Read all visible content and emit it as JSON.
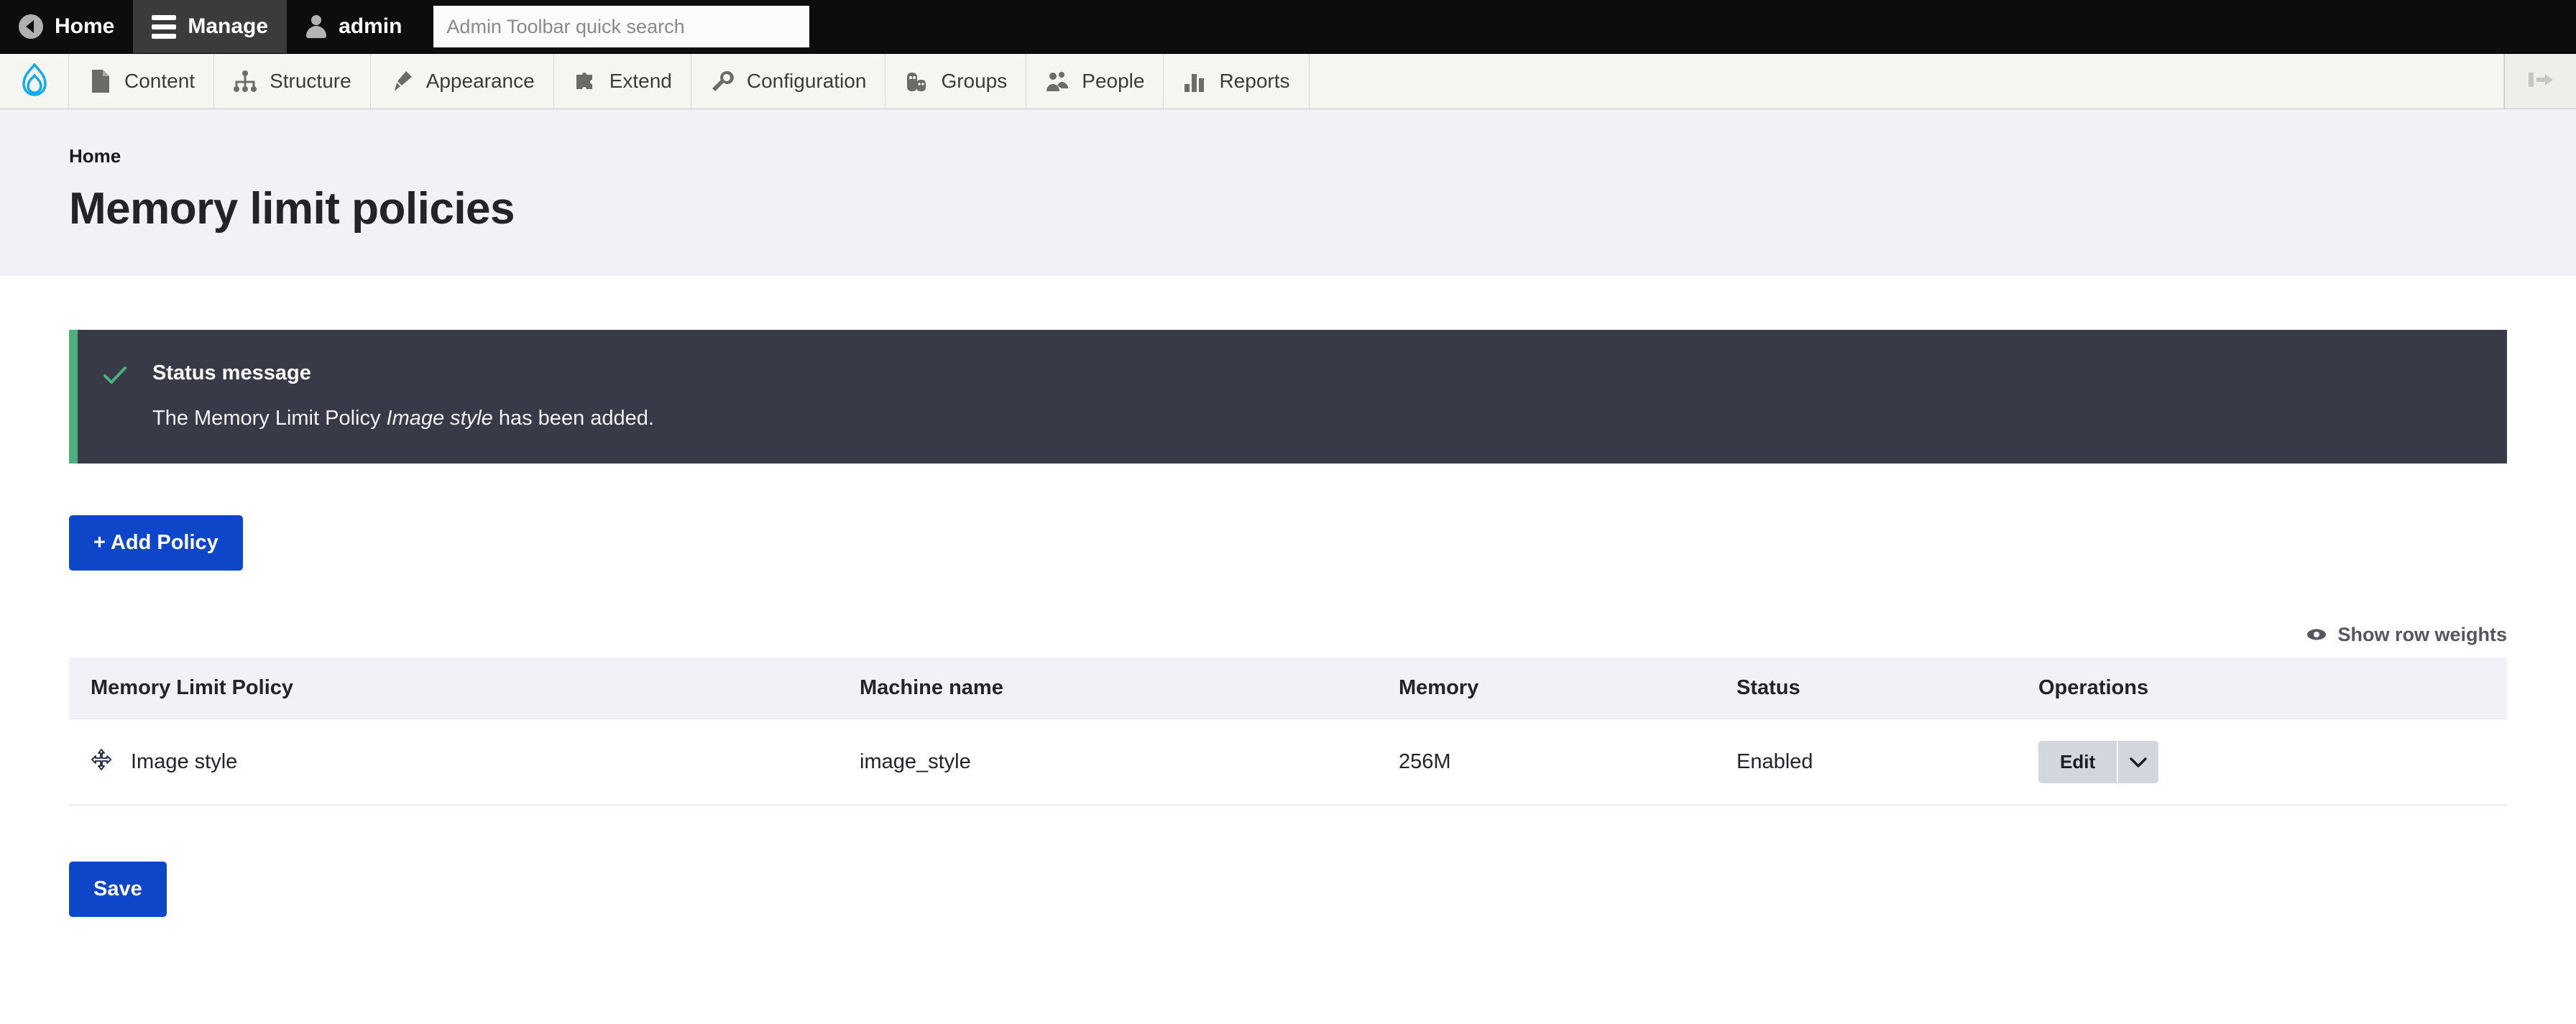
{
  "toolbar_top": {
    "tabs": [
      {
        "label": "Home",
        "icon": "home-back-icon",
        "active": false
      },
      {
        "label": "Manage",
        "icon": "hamburger-icon",
        "active": true
      },
      {
        "label": "admin",
        "icon": "user-icon",
        "active": false
      }
    ],
    "search": {
      "placeholder": "Admin Toolbar quick search",
      "value": ""
    }
  },
  "admin_menu": {
    "logo": "drupal-drop-logo",
    "items": [
      {
        "label": "Content",
        "icon": "document-icon"
      },
      {
        "label": "Structure",
        "icon": "sitemap-icon"
      },
      {
        "label": "Appearance",
        "icon": "paintbrush-icon"
      },
      {
        "label": "Extend",
        "icon": "puzzle-piece-icon"
      },
      {
        "label": "Configuration",
        "icon": "wrench-icon"
      },
      {
        "label": "Groups",
        "icon": "people-group-icon"
      },
      {
        "label": "People",
        "icon": "person-group-icon"
      },
      {
        "label": "Reports",
        "icon": "bar-chart-icon"
      }
    ],
    "orientation_toggle": "collapse-sidebar-icon"
  },
  "page": {
    "breadcrumb": "Home",
    "title": "Memory limit policies"
  },
  "status_message": {
    "icon": "checkmark-icon",
    "title": "Status message",
    "text_before": "The Memory Limit Policy ",
    "text_emphasis": "Image style",
    "text_after": " has been added.",
    "accent_color": "#4caf7d",
    "background_color": "#383a47"
  },
  "actions": {
    "add_policy_label": "+ Add Policy",
    "save_label": "Save",
    "primary_color": "#0d46c9"
  },
  "row_weights": {
    "label": "Show row weights",
    "icon": "eye-icon"
  },
  "table": {
    "columns": [
      "Memory Limit Policy",
      "Machine name",
      "Memory",
      "Status",
      "Operations"
    ],
    "rows": [
      {
        "drag_handle": "drag-move-icon",
        "policy": "Image style",
        "machine_name": "image_style",
        "memory": "256M",
        "status": "Enabled",
        "operation_label": "Edit",
        "operation_toggle": "chevron-down-icon"
      }
    ]
  }
}
